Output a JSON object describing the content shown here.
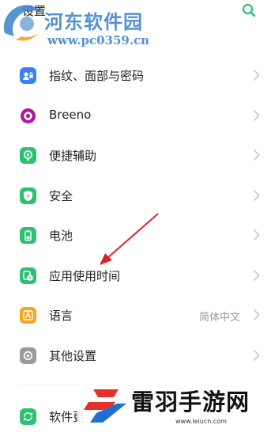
{
  "header": {
    "title": "设置",
    "search_icon": "search-icon"
  },
  "watermark_top": {
    "name": "河东软件园",
    "url": "www.pc0359.cn"
  },
  "settings": {
    "items": [
      {
        "label": "指纹、面部与密码",
        "icon": "fingerprint-face-icon",
        "color": "#3b7ff5"
      },
      {
        "label": "Breeno",
        "icon": "breeno-icon",
        "color": "#b0159b"
      },
      {
        "label": "便捷辅助",
        "icon": "accessibility-icon",
        "color": "#2fbf71"
      },
      {
        "label": "安全",
        "icon": "shield-icon",
        "color": "#2fbf71"
      },
      {
        "label": "电池",
        "icon": "battery-icon",
        "color": "#2fbf71"
      },
      {
        "label": "应用使用时间",
        "icon": "app-usage-time-icon",
        "color": "#2fbf71"
      },
      {
        "label": "语言",
        "icon": "language-icon",
        "color": "#f5a623",
        "value": "简体中文"
      },
      {
        "label": "其他设置",
        "icon": "other-settings-icon",
        "color": "#9b9b9b"
      }
    ],
    "partial_item": {
      "label": "软件更",
      "icon": "software-update-icon",
      "color": "#2fbf71"
    }
  },
  "watermark_bottom": {
    "name": "雷羽手游网",
    "url": "www.leiucn.com"
  },
  "colors": {
    "annotation_arrow": "#d8242a",
    "chevron": "#c4c4c4"
  }
}
